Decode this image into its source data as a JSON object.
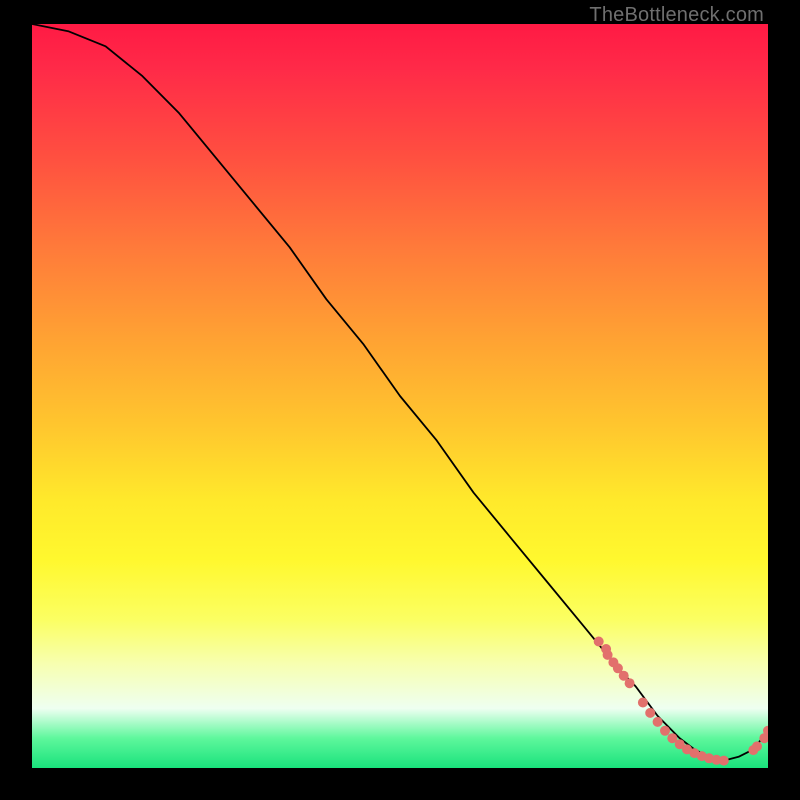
{
  "watermark": {
    "text": "TheBottleneck.com"
  },
  "chart_data": {
    "type": "line",
    "title": "",
    "xlabel": "",
    "ylabel": "",
    "xlim": [
      0,
      100
    ],
    "ylim": [
      0,
      100
    ],
    "series": [
      {
        "name": "bottleneck-curve",
        "x": [
          0,
          5,
          10,
          15,
          20,
          25,
          30,
          35,
          40,
          45,
          50,
          55,
          60,
          65,
          70,
          75,
          80,
          82,
          85,
          88,
          90,
          92,
          94,
          96,
          98,
          100
        ],
        "y": [
          100,
          99,
          97,
          93,
          88,
          82,
          76,
          70,
          63,
          57,
          50,
          44,
          37,
          31,
          25,
          19,
          13,
          11,
          7,
          4,
          2.5,
          1.5,
          1,
          1.5,
          2.5,
          5
        ]
      }
    ],
    "markers": [
      {
        "name": "cluster-upper",
        "points": [
          {
            "x": 77.0,
            "y": 17.0
          },
          {
            "x": 78.0,
            "y": 16.0
          },
          {
            "x": 78.2,
            "y": 15.2
          },
          {
            "x": 79.0,
            "y": 14.2
          },
          {
            "x": 79.6,
            "y": 13.4
          },
          {
            "x": 80.4,
            "y": 12.4
          },
          {
            "x": 81.2,
            "y": 11.4
          }
        ]
      },
      {
        "name": "cluster-lower",
        "points": [
          {
            "x": 83.0,
            "y": 8.8
          },
          {
            "x": 84.0,
            "y": 7.4
          },
          {
            "x": 85.0,
            "y": 6.2
          },
          {
            "x": 86.0,
            "y": 5.0
          },
          {
            "x": 87.0,
            "y": 4.0
          },
          {
            "x": 88.0,
            "y": 3.2
          },
          {
            "x": 89.0,
            "y": 2.5
          },
          {
            "x": 90.0,
            "y": 2.0
          },
          {
            "x": 91.0,
            "y": 1.6
          },
          {
            "x": 92.0,
            "y": 1.3
          },
          {
            "x": 93.0,
            "y": 1.1
          },
          {
            "x": 94.0,
            "y": 1.0
          }
        ]
      },
      {
        "name": "cluster-right",
        "points": [
          {
            "x": 98.0,
            "y": 2.4
          },
          {
            "x": 98.5,
            "y": 2.9
          },
          {
            "x": 99.5,
            "y": 4.0
          },
          {
            "x": 100.0,
            "y": 5.0
          }
        ]
      }
    ],
    "marker_style": {
      "color": "#e2706c",
      "radius_px": 5
    }
  }
}
